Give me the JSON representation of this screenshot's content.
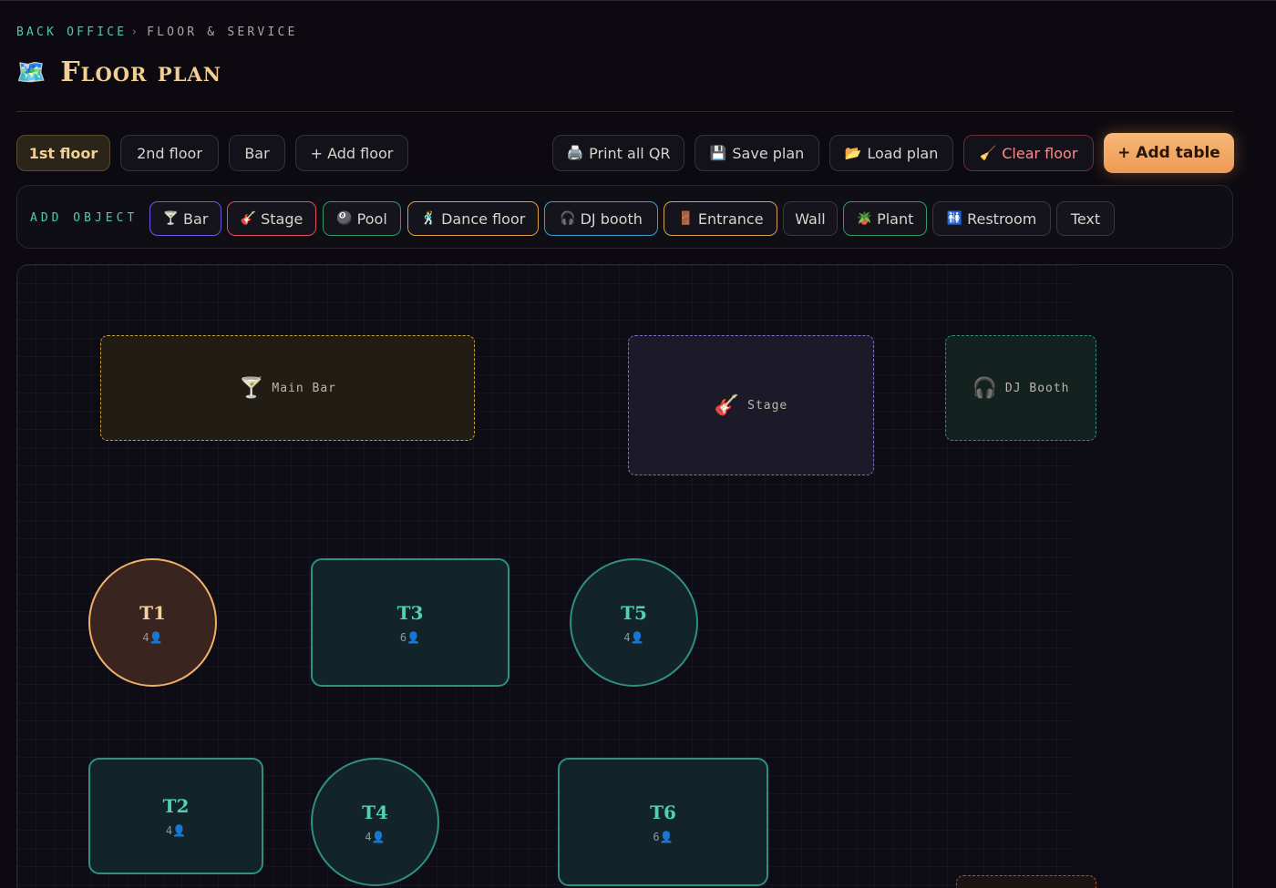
{
  "breadcrumb": {
    "root": "BACK OFFICE",
    "separator": "›",
    "current": "FLOOR & SERVICE"
  },
  "page": {
    "icon": "🗺️",
    "title": "Floor plan"
  },
  "floors": [
    {
      "label": "1st floor",
      "active": true
    },
    {
      "label": "2nd floor"
    },
    {
      "label": "Bar"
    },
    {
      "label": "+ Add floor"
    }
  ],
  "toolbar": {
    "print_qr": {
      "icon": "🖨️",
      "label": "Print all QR"
    },
    "save_plan": {
      "icon": "💾",
      "label": "Save plan"
    },
    "load_plan": {
      "icon": "📂",
      "label": "Load plan"
    },
    "clear_floor": {
      "icon": "🧹",
      "label": "Clear floor"
    },
    "add_table": {
      "label": "+ Add table"
    }
  },
  "add_object": {
    "label": "ADD OBJECT",
    "items": [
      {
        "icon": "🍸",
        "label": "Bar",
        "color": "#6c5ce7"
      },
      {
        "icon": "🎸",
        "label": "Stage",
        "color": "#e05060"
      },
      {
        "icon": "🎱",
        "label": "Pool",
        "color": "#2f9a6a"
      },
      {
        "icon": "🕺",
        "label": "Dance floor",
        "color": "#e0a040"
      },
      {
        "icon": "🎧",
        "label": "DJ booth",
        "color": "#3aa0d0"
      },
      {
        "icon": "🚪",
        "label": "Entrance",
        "color": "#d8a050"
      },
      {
        "icon": "",
        "label": "Wall",
        "color": "#3a3740"
      },
      {
        "icon": "🪴",
        "label": "Plant",
        "color": "#2f9a6a"
      },
      {
        "icon": "🚻",
        "label": "Restroom",
        "color": "#3a3740"
      },
      {
        "icon": "",
        "label": "Text",
        "color": "#3a3740"
      }
    ]
  },
  "zones": [
    {
      "icon": "🍸",
      "label": "Main Bar",
      "color": "#c9a030",
      "fill": "#221d14"
    },
    {
      "icon": "🎸",
      "label": "Stage",
      "color": "#8070c0",
      "fill": "#1c1928"
    },
    {
      "icon": "🎧",
      "label": "DJ Booth",
      "color": "#2f8f7a",
      "fill": "#13211f"
    }
  ],
  "tables": [
    {
      "name": "T1",
      "seats": "4👤",
      "shape": "round",
      "selected": true
    },
    {
      "name": "T3",
      "seats": "6👤",
      "shape": "rect"
    },
    {
      "name": "T5",
      "seats": "4👤",
      "shape": "round"
    },
    {
      "name": "T2",
      "seats": "4👤",
      "shape": "rect"
    },
    {
      "name": "T4",
      "seats": "4👤",
      "shape": "round"
    },
    {
      "name": "T6",
      "seats": "6👤",
      "shape": "rect"
    }
  ]
}
